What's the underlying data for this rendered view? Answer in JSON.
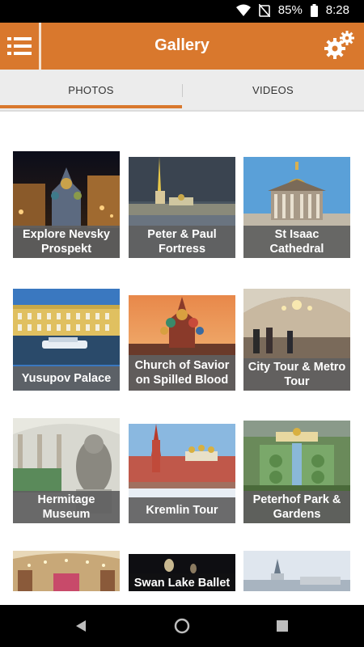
{
  "status_bar": {
    "battery": "85%",
    "time": "8:28"
  },
  "app_bar": {
    "title": "Gallery"
  },
  "tabs": [
    {
      "label": "PHOTOS",
      "selected": true
    },
    {
      "label": "VIDEOS",
      "selected": false
    }
  ],
  "gallery": [
    {
      "caption": "Explore Nevsky Prospekt"
    },
    {
      "caption": "Peter & Paul Fortress"
    },
    {
      "caption": "St Isaac Cathedral"
    },
    {
      "caption": "Yusupov Palace"
    },
    {
      "caption": "Church of Savior on Spilled Blood"
    },
    {
      "caption": "City Tour & Metro Tour"
    },
    {
      "caption": "Hermitage Museum"
    },
    {
      "caption": "Kremlin Tour"
    },
    {
      "caption": "Peterhof Park & Gardens"
    },
    {
      "caption": ""
    },
    {
      "caption": "Swan Lake Ballet"
    },
    {
      "caption": ""
    }
  ],
  "colors": {
    "accent": "#d9782d",
    "caption_bg": "#606060"
  }
}
